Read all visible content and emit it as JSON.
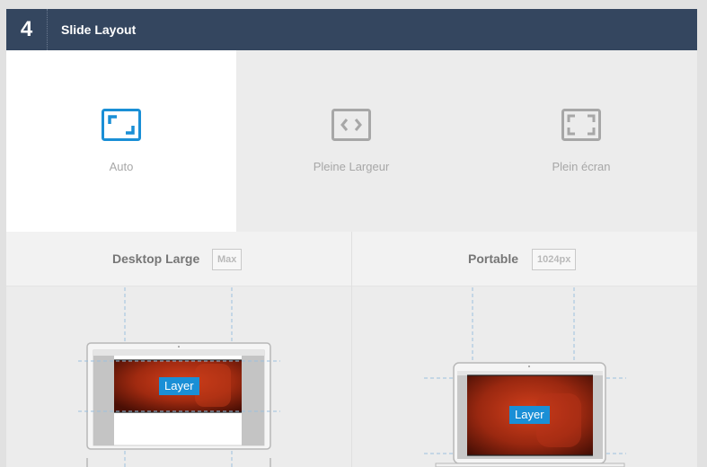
{
  "header": {
    "step_number": "4",
    "title": "Slide Layout"
  },
  "layout_options": [
    {
      "label": "Auto",
      "icon": "auto-layout-icon",
      "selected": true
    },
    {
      "label": "Pleine Largeur",
      "icon": "code-brackets-icon",
      "selected": false
    },
    {
      "label": "Plein écran",
      "icon": "fullscreen-icon",
      "selected": false
    }
  ],
  "devices": [
    {
      "name": "Desktop Large",
      "badge": "Max",
      "preview_label": "Layer"
    },
    {
      "name": "Portable",
      "badge": "1024px",
      "preview_label": "Layer"
    }
  ],
  "colors": {
    "header_bg": "#34465f",
    "accent": "#1a8fd6",
    "icon_inactive": "#a7a7a7",
    "slide_red": "#b02a12"
  }
}
